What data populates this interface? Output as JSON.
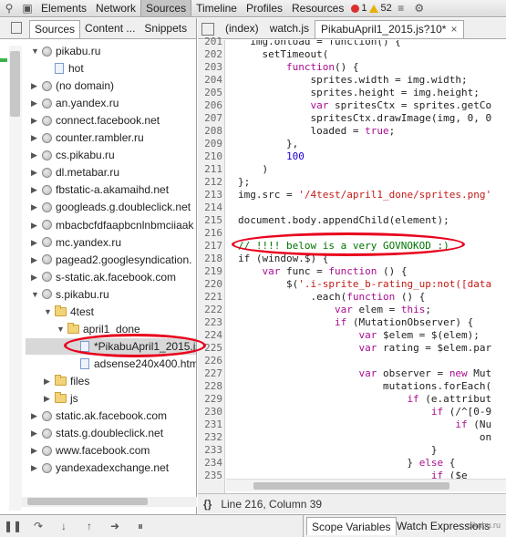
{
  "toolbar": {
    "tabs": [
      "Elements",
      "Network",
      "Sources",
      "Timeline",
      "Profiles",
      "Resources"
    ],
    "active_tab": "Sources",
    "error_count": "1",
    "warning_count": "52",
    "icons": [
      "search-icon",
      "device-icon"
    ]
  },
  "navigator": {
    "tabs": [
      "Sources",
      "Content ...",
      "Snippets"
    ],
    "active_tab": "Sources",
    "tree": [
      {
        "label": "pikabu.ru",
        "kind": "domain",
        "expanded": true,
        "depth": 0
      },
      {
        "label": "hot",
        "kind": "file",
        "depth": 1
      },
      {
        "label": "(no domain)",
        "kind": "domain",
        "depth": 0
      },
      {
        "label": "an.yandex.ru",
        "kind": "domain",
        "depth": 0
      },
      {
        "label": "connect.facebook.net",
        "kind": "domain",
        "depth": 0
      },
      {
        "label": "counter.rambler.ru",
        "kind": "domain",
        "depth": 0
      },
      {
        "label": "cs.pikabu.ru",
        "kind": "domain",
        "depth": 0
      },
      {
        "label": "dl.metabar.ru",
        "kind": "domain",
        "depth": 0
      },
      {
        "label": "fbstatic-a.akamaihd.net",
        "kind": "domain",
        "depth": 0
      },
      {
        "label": "googleads.g.doubleclick.net",
        "kind": "domain",
        "depth": 0
      },
      {
        "label": "mbacbcfdfaapbcnlnbmciiaak",
        "kind": "domain",
        "depth": 0
      },
      {
        "label": "mc.yandex.ru",
        "kind": "domain",
        "depth": 0
      },
      {
        "label": "pagead2.googlesyndication.",
        "kind": "domain",
        "depth": 0
      },
      {
        "label": "s-static.ak.facebook.com",
        "kind": "domain",
        "depth": 0
      },
      {
        "label": "s.pikabu.ru",
        "kind": "domain",
        "expanded": true,
        "depth": 0
      },
      {
        "label": "4test",
        "kind": "folder",
        "expanded": true,
        "depth": 1
      },
      {
        "label": "april1_done",
        "kind": "folder",
        "expanded": true,
        "depth": 2
      },
      {
        "label": "*PikabuApril1_2015.js",
        "kind": "file",
        "depth": 3,
        "selected": true
      },
      {
        "label": "adsense240x400.html",
        "kind": "file",
        "depth": 3
      },
      {
        "label": "files",
        "kind": "folder",
        "depth": 1
      },
      {
        "label": "js",
        "kind": "folder",
        "depth": 1
      },
      {
        "label": "static.ak.facebook.com",
        "kind": "domain",
        "depth": 0
      },
      {
        "label": "stats.g.doubleclick.net",
        "kind": "domain",
        "depth": 0
      },
      {
        "label": "www.facebook.com",
        "kind": "domain",
        "depth": 0
      },
      {
        "label": "yandexadexchange.net",
        "kind": "domain",
        "depth": 0
      }
    ]
  },
  "editor": {
    "tabs": [
      {
        "label": "(index)",
        "active": false
      },
      {
        "label": "watch.js",
        "active": false
      },
      {
        "label": "PikabuApril1_2015.js?10*",
        "active": true
      }
    ],
    "first_line": 201,
    "lines": [
      [
        {
          "t": "  img.onload = function() {",
          "c": ""
        }
      ],
      [
        {
          "t": "    setTimeout(",
          "c": ""
        }
      ],
      [
        {
          "t": "        ",
          "c": ""
        },
        {
          "t": "function",
          "c": "kw"
        },
        {
          "t": "() {",
          "c": ""
        }
      ],
      [
        {
          "t": "            sprites.width = img.width;",
          "c": ""
        }
      ],
      [
        {
          "t": "            sprites.height = img.height;",
          "c": ""
        }
      ],
      [
        {
          "t": "            ",
          "c": ""
        },
        {
          "t": "var",
          "c": "kw"
        },
        {
          "t": " spritesCtx = sprites.getCo",
          "c": ""
        }
      ],
      [
        {
          "t": "            spritesCtx.drawImage(img, 0, 0",
          "c": ""
        }
      ],
      [
        {
          "t": "            loaded = ",
          "c": ""
        },
        {
          "t": "true",
          "c": "kw"
        },
        {
          "t": ";",
          "c": ""
        }
      ],
      [
        {
          "t": "        },",
          "c": ""
        }
      ],
      [
        {
          "t": "        ",
          "c": ""
        },
        {
          "t": "100",
          "c": "num"
        }
      ],
      [
        {
          "t": "    )",
          "c": ""
        }
      ],
      [
        {
          "t": "};",
          "c": ""
        }
      ],
      [
        {
          "t": "img.src = ",
          "c": ""
        },
        {
          "t": "'/4test/april1_done/sprites.png'",
          "c": "str"
        }
      ],
      [
        {
          "t": "",
          "c": ""
        }
      ],
      [
        {
          "t": "document.body.appendChild(element);",
          "c": ""
        }
      ],
      [
        {
          "t": "",
          "c": ""
        }
      ],
      [
        {
          "t": "// !!!! below is a very GOVNOKOD :)",
          "c": "cmt"
        }
      ],
      [
        {
          "t": "if (window.$) {",
          "c": ""
        }
      ],
      [
        {
          "t": "    ",
          "c": ""
        },
        {
          "t": "var",
          "c": "kw"
        },
        {
          "t": " func = ",
          "c": ""
        },
        {
          "t": "function",
          "c": "kw"
        },
        {
          "t": " () {",
          "c": ""
        }
      ],
      [
        {
          "t": "        $(",
          "c": ""
        },
        {
          "t": "'.i-sprite_b-rating_up:not([data",
          "c": "str"
        }
      ],
      [
        {
          "t": "            .each(",
          "c": ""
        },
        {
          "t": "function",
          "c": "kw"
        },
        {
          "t": " () {",
          "c": ""
        }
      ],
      [
        {
          "t": "                ",
          "c": ""
        },
        {
          "t": "var",
          "c": "kw"
        },
        {
          "t": " elem = ",
          "c": ""
        },
        {
          "t": "this",
          "c": "kw"
        },
        {
          "t": ";",
          "c": ""
        }
      ],
      [
        {
          "t": "                ",
          "c": ""
        },
        {
          "t": "if",
          "c": "kw"
        },
        {
          "t": " (MutationObserver) {",
          "c": ""
        }
      ],
      [
        {
          "t": "                    ",
          "c": ""
        },
        {
          "t": "var",
          "c": "kw"
        },
        {
          "t": " $elem = $(elem);",
          "c": ""
        }
      ],
      [
        {
          "t": "                    ",
          "c": ""
        },
        {
          "t": "var",
          "c": "kw"
        },
        {
          "t": " rating = $elem.par",
          "c": ""
        }
      ],
      [
        {
          "t": "",
          "c": ""
        }
      ],
      [
        {
          "t": "                    ",
          "c": ""
        },
        {
          "t": "var",
          "c": "kw"
        },
        {
          "t": " observer = ",
          "c": ""
        },
        {
          "t": "new",
          "c": "kw"
        },
        {
          "t": " Mut",
          "c": ""
        }
      ],
      [
        {
          "t": "                        mutations.forEach(",
          "c": ""
        }
      ],
      [
        {
          "t": "                            ",
          "c": ""
        },
        {
          "t": "if",
          "c": "kw"
        },
        {
          "t": " (e.attribut",
          "c": ""
        }
      ],
      [
        {
          "t": "                                ",
          "c": ""
        },
        {
          "t": "if",
          "c": "kw"
        },
        {
          "t": " (/^[0-9",
          "c": ""
        }
      ],
      [
        {
          "t": "                                    ",
          "c": ""
        },
        {
          "t": "if",
          "c": "kw"
        },
        {
          "t": " (Nu",
          "c": ""
        }
      ],
      [
        {
          "t": "                                        on",
          "c": ""
        }
      ],
      [
        {
          "t": "                                }",
          "c": ""
        }
      ],
      [
        {
          "t": "                            } ",
          "c": ""
        },
        {
          "t": "else",
          "c": "kw"
        },
        {
          "t": " {",
          "c": ""
        }
      ],
      [
        {
          "t": "                                ",
          "c": ""
        },
        {
          "t": "if",
          "c": "kw"
        },
        {
          "t": " ($e",
          "c": ""
        }
      ]
    ]
  },
  "status": {
    "braces_label": "{}",
    "position": "Line 216, Column 39"
  },
  "debugger": {
    "buttons": [
      "pause-icon",
      "step-over-icon",
      "step-into-icon",
      "step-out-icon",
      "deactivate-breakpoints-icon",
      "pause-on-exceptions-icon"
    ],
    "pane_tabs": [
      "Scope Variables",
      "Watch Expressions"
    ],
    "active_pane": "Scope Variables",
    "watermark": "pikabu.ru"
  },
  "annotation_color": "#e8001c"
}
